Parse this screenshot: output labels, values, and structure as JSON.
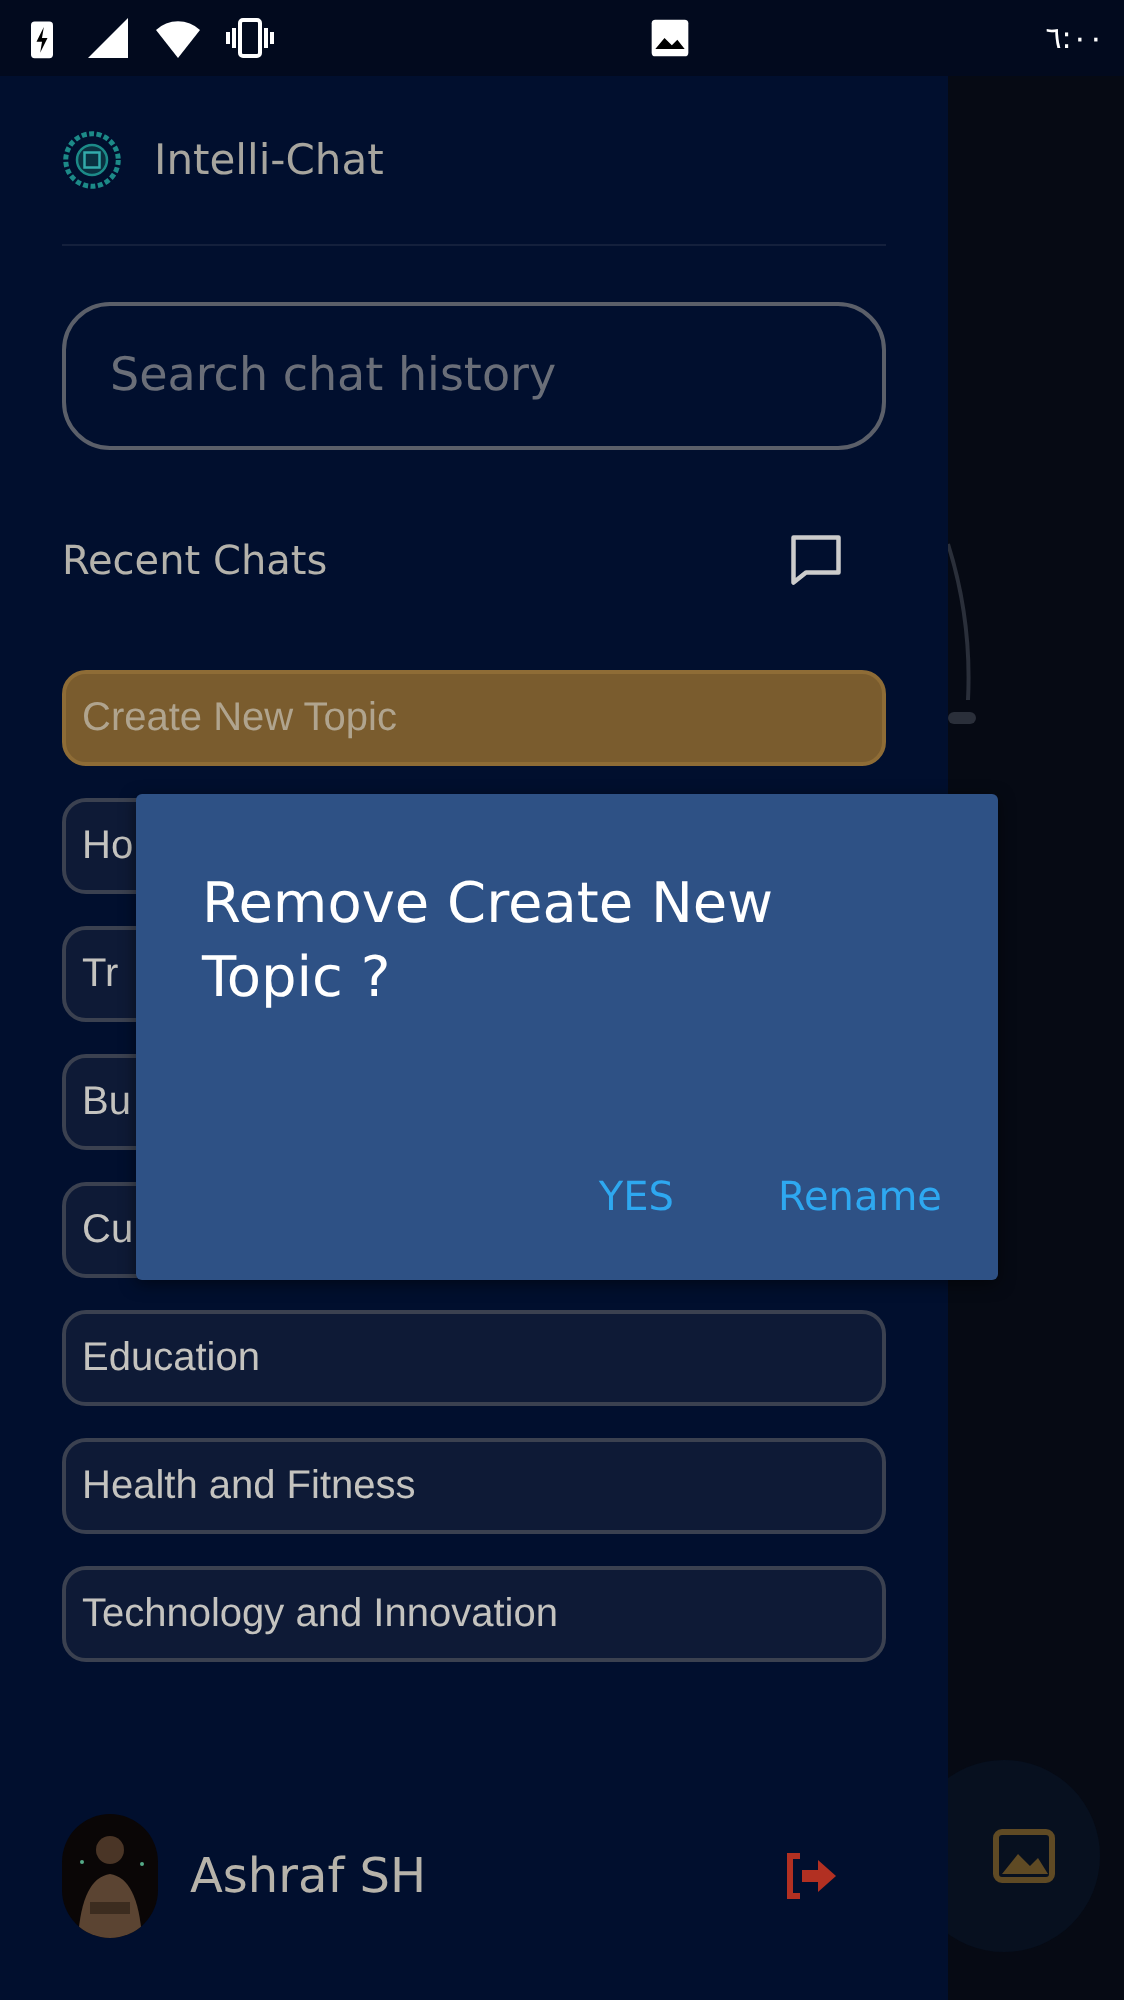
{
  "status_bar": {
    "time": "٦:٠٠"
  },
  "app": {
    "title": "Intelli-Chat"
  },
  "search": {
    "placeholder": "Search chat history"
  },
  "recent": {
    "label": "Recent Chats"
  },
  "chats": [
    {
      "label": "Create New Topic",
      "selected": true
    },
    {
      "label": "Ho",
      "selected": false
    },
    {
      "label": "Tr",
      "selected": false
    },
    {
      "label": "Bu",
      "selected": false
    },
    {
      "label": "Cu",
      "selected": false
    },
    {
      "label": "Education",
      "selected": false
    },
    {
      "label": "Health and Fitness",
      "selected": false
    },
    {
      "label": "Technology and Innovation",
      "selected": false
    }
  ],
  "user": {
    "name": "Ashraf SH"
  },
  "dialog": {
    "message": "Remove Create New Topic ?",
    "buttons": [
      "YES",
      "Rename"
    ]
  }
}
